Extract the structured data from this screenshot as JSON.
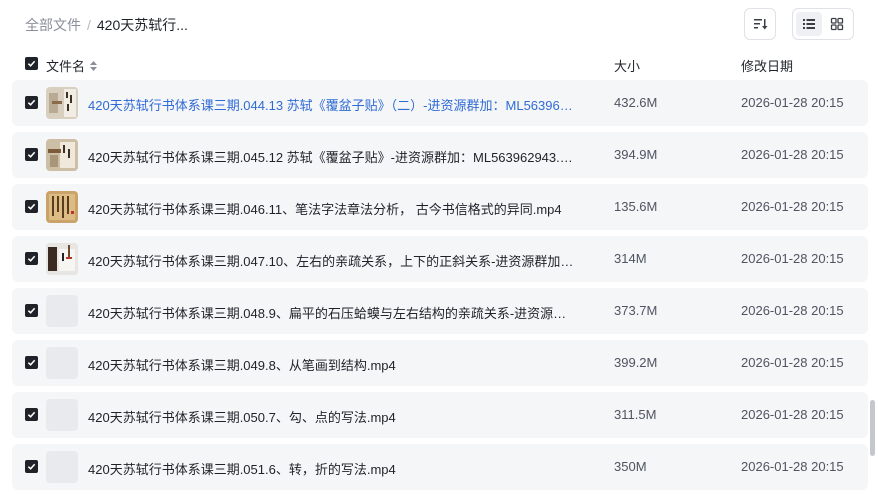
{
  "breadcrumb": {
    "root": "全部文件",
    "separator": "/",
    "current": "420天苏轼行..."
  },
  "table": {
    "headers": {
      "name": "文件名",
      "size": "大小",
      "date": "修改日期"
    },
    "rows": [
      {
        "name": "420天苏轼行书体系课三期.044.13 苏轼《覆盆子贴》（二）-进资源群加：ML56396294...",
        "size": "432.6M",
        "date": "2026-01-28 20:15",
        "thumb": "calligraphy-photo-icon",
        "highlight": true
      },
      {
        "name": "420天苏轼行书体系课三期.045.12 苏轼《覆盆子贴》-进资源群加：ML563962943.mp4",
        "size": "394.9M",
        "date": "2026-01-28 20:15",
        "thumb": "calligraphy-photo-icon",
        "highlight": false
      },
      {
        "name": "420天苏轼行书体系课三期.046.11、笔法字法章法分析， 古今书信格式的异同.mp4",
        "size": "135.6M",
        "date": "2026-01-28 20:15",
        "thumb": "scroll-photo-icon",
        "highlight": false
      },
      {
        "name": "420天苏轼行书体系课三期.047.10、左右的亲疏关系，上下的正斜关系-进资源群加：ML...",
        "size": "314M",
        "date": "2026-01-28 20:15",
        "thumb": "brush-photo-icon",
        "highlight": false
      },
      {
        "name": "420天苏轼行书体系课三期.048.9、扁平的石压蛤蟆与左右结构的亲疏关系-进资源群加：...",
        "size": "373.7M",
        "date": "2026-01-28 20:15",
        "thumb": "placeholder-icon",
        "highlight": false
      },
      {
        "name": "420天苏轼行书体系课三期.049.8、从笔画到结构.mp4",
        "size": "399.2M",
        "date": "2026-01-28 20:15",
        "thumb": "placeholder-icon",
        "highlight": false
      },
      {
        "name": "420天苏轼行书体系课三期.050.7、勾、点的写法.mp4",
        "size": "311.5M",
        "date": "2026-01-28 20:15",
        "thumb": "placeholder-icon",
        "highlight": false
      },
      {
        "name": "420天苏轼行书体系课三期.051.6、转，折的写法.mp4",
        "size": "350M",
        "date": "2026-01-28 20:15",
        "thumb": "placeholder-icon",
        "highlight": false
      }
    ]
  },
  "colors": {
    "accent": "#2f6bd6",
    "row_bg": "#f5f6f8",
    "checkbox": "#1f2329"
  }
}
